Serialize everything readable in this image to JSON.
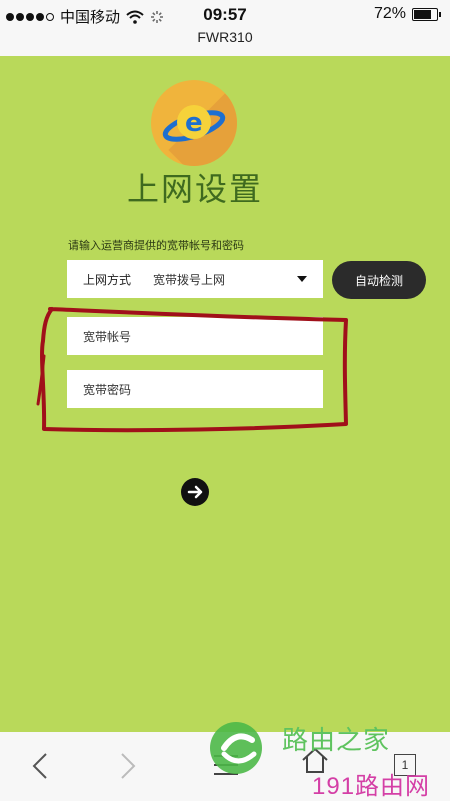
{
  "status_bar": {
    "carrier": "中国移动",
    "time": "09:57",
    "battery": "72%"
  },
  "browser": {
    "page_title": "FWR310",
    "tab_count": "1"
  },
  "setup": {
    "title": "上网设置",
    "hint": "请输入运营商提供的宽带帐号和密码",
    "method_label": "上网方式",
    "method_value": "宽带拨号上网",
    "auto_detect_label": "自动检测",
    "account_placeholder": "宽带帐号",
    "password_placeholder": "宽带密码"
  },
  "watermark": {
    "text_top": "路由之家",
    "text_bottom": "191路由网"
  },
  "colors": {
    "page_bg": "#b9d95a",
    "title": "#3f6a1f",
    "annotation": "#a0101a",
    "button_dark": "#2b2b2b"
  }
}
